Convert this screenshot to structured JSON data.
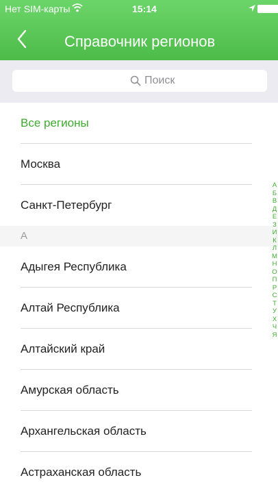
{
  "status": {
    "carrier": "Нет SIM-карты",
    "time": "15:14"
  },
  "nav": {
    "title": "Справочник регионов"
  },
  "search": {
    "placeholder": "Поиск"
  },
  "colors": {
    "accent": "#3eab2e",
    "header": "#4cbb48"
  },
  "icons": {
    "back": "chevron-left-icon",
    "search": "search-icon",
    "wifi": "wifi-icon",
    "location": "location-icon",
    "battery": "battery-icon"
  },
  "list": {
    "top_items": [
      {
        "label": "Все регионы"
      },
      {
        "label": "Москва"
      },
      {
        "label": "Санкт-Петербург"
      }
    ],
    "section": "А",
    "section_items": [
      {
        "label": "Адыгея Республика"
      },
      {
        "label": "Алтай Республика"
      },
      {
        "label": "Алтайский край"
      },
      {
        "label": "Амурская область"
      },
      {
        "label": "Архангельская область"
      },
      {
        "label": "Астраханская область"
      }
    ]
  },
  "index": [
    "А",
    "Б",
    "В",
    "Д",
    "Е",
    "З",
    "И",
    "К",
    "Л",
    "М",
    "Н",
    "О",
    "П",
    "Р",
    "С",
    "Т",
    "У",
    "Х",
    "Ч",
    "Я"
  ]
}
